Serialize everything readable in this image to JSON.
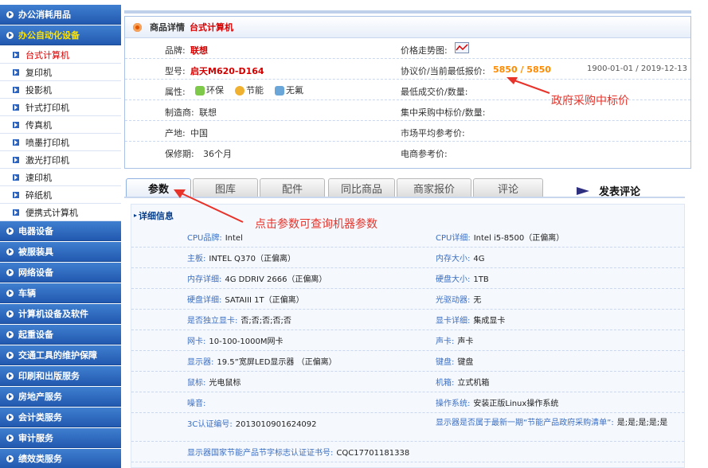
{
  "sidebar": {
    "groups_top": [
      {
        "label": "办公消耗用品",
        "active": false
      },
      {
        "label": "办公自动化设备",
        "active": true
      }
    ],
    "sub_items": [
      {
        "label": "台式计算机",
        "current": true
      },
      {
        "label": "复印机",
        "current": false
      },
      {
        "label": "投影机",
        "current": false
      },
      {
        "label": "针式打印机",
        "current": false
      },
      {
        "label": "传真机",
        "current": false
      },
      {
        "label": "喷墨打印机",
        "current": false
      },
      {
        "label": "激光打印机",
        "current": false
      },
      {
        "label": "速印机",
        "current": false
      },
      {
        "label": "碎纸机",
        "current": false
      },
      {
        "label": "便携式计算机",
        "current": false
      }
    ],
    "groups_bottom": [
      {
        "label": "电器设备"
      },
      {
        "label": "被服装具"
      },
      {
        "label": "网络设备"
      },
      {
        "label": "车辆"
      },
      {
        "label": "计算机设备及软件"
      },
      {
        "label": "起重设备"
      },
      {
        "label": "交通工具的维护保障"
      },
      {
        "label": "印刷和出版服务"
      },
      {
        "label": "房地产服务"
      },
      {
        "label": "会计类服务"
      },
      {
        "label": "审计服务"
      },
      {
        "label": "绩效类服务"
      }
    ]
  },
  "detail": {
    "header_label": "商品详情",
    "header_model": "台式计算机",
    "brand_label": "品牌:",
    "brand_value": "联想",
    "model_label": "型号:",
    "model_value": "启天M620-D164",
    "attr_label": "属性:",
    "attrs": [
      "环保",
      "节能",
      "无氟"
    ],
    "maker_label": "制造商:",
    "maker_value": "联想",
    "origin_label": "产地:",
    "origin_value": "中国",
    "warranty_label": "保修期:",
    "warranty_value": "36个月",
    "trend_label": "价格走势图:",
    "price_label": "协议价/当前最低报价:",
    "price_value": "5850 / 5850",
    "price_period": "1900-01-01 / 2019-12-13",
    "deal_label": "最低成交价/数量:",
    "central_label": "集中采购中标价/数量:",
    "market_label": "市场平均参考价:",
    "ecommerce_label": "电商参考价:"
  },
  "tabs": [
    "参数",
    "图库",
    "配件",
    "同比商品",
    "商家报价",
    "评论"
  ],
  "comment_tab": "发表评论",
  "params": {
    "title": "详细信息",
    "rows": [
      [
        {
          "k": "CPU品牌:",
          "v": "Intel"
        },
        {
          "k": "CPU详细:",
          "v": "Intel i5-8500（正偏离）"
        }
      ],
      [
        {
          "k": "主板:",
          "v": "INTEL Q370（正偏离）"
        },
        {
          "k": "内存大小:",
          "v": "4G"
        }
      ],
      [
        {
          "k": "内存详细:",
          "v": "4G DDRIV 2666（正偏离）"
        },
        {
          "k": "硬盘大小:",
          "v": "1TB"
        }
      ],
      [
        {
          "k": "硬盘详细:",
          "v": "SATAIII 1T（正偏离）"
        },
        {
          "k": "光驱动器:",
          "v": "无"
        }
      ],
      [
        {
          "k": "是否独立显卡:",
          "v": "否;否;否;否;否"
        },
        {
          "k": "显卡详细:",
          "v": "集成显卡"
        }
      ],
      [
        {
          "k": "网卡:",
          "v": "10-100-1000M网卡"
        },
        {
          "k": "声卡:",
          "v": "声卡"
        }
      ],
      [
        {
          "k": "显示器:",
          "v": "19.5”宽屏LED显示器 （正偏离）"
        },
        {
          "k": "键盘:",
          "v": "键盘"
        }
      ],
      [
        {
          "k": "鼠标:",
          "v": "光电鼠标"
        },
        {
          "k": "机箱:",
          "v": "立式机箱"
        }
      ],
      [
        {
          "k": "噪音:",
          "v": ""
        },
        {
          "k": "操作系统:",
          "v": "安装正版Linux操作系统"
        }
      ],
      [
        {
          "k": "3C认证编号:",
          "v": "2013010901624092"
        },
        {
          "k": "显示器是否属于最新一期“节能产品政府采购清单”:",
          "v": "是;是;是;是;是"
        }
      ],
      [
        {
          "k": "显示器国家节能产品节字标志认证证书号:",
          "v": "CQC17701181338"
        },
        {
          "k": "",
          "v": ""
        }
      ]
    ]
  },
  "annotations": {
    "price_note": "政府采购中标价",
    "params_note": "点击参数可查询机器参数"
  },
  "colors": {
    "accent_red": "#d40000",
    "price_orange": "#ff8a00",
    "annot_red": "#e8332a",
    "sidebar_blue": "#2259b0"
  },
  "icons": [
    "chart-icon",
    "leaf-icon",
    "flower-icon",
    "cube-icon",
    "flag-icon"
  ]
}
